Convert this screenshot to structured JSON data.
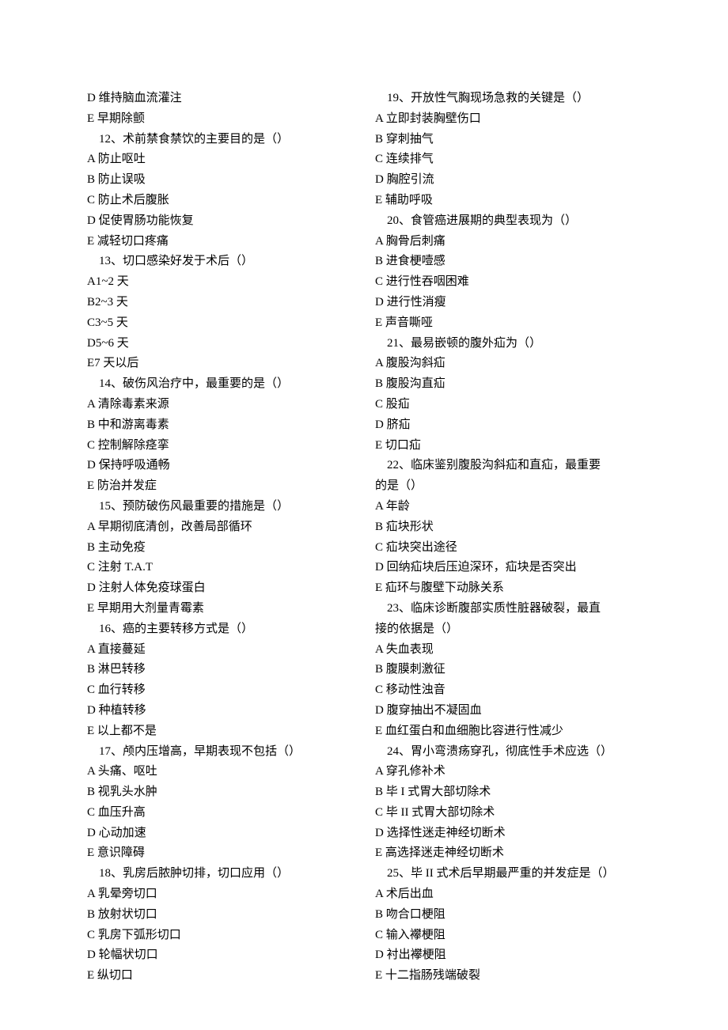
{
  "left": [
    {
      "t": "D 维持脑血流灌注"
    },
    {
      "t": "E 早期除颤"
    },
    {
      "t": "　12、术前禁食禁饮的主要目的是（）"
    },
    {
      "t": "A 防止呕吐"
    },
    {
      "t": "B 防止误吸"
    },
    {
      "t": "C 防止术后腹胀"
    },
    {
      "t": "D 促使胃肠功能恢复"
    },
    {
      "t": "E 减轻切口疼痛"
    },
    {
      "t": "　13、切口感染好发于术后（）"
    },
    {
      "t": "A1~2 天"
    },
    {
      "t": "B2~3 天"
    },
    {
      "t": "C3~5 天"
    },
    {
      "t": "D5~6 天"
    },
    {
      "t": "E7 天以后"
    },
    {
      "t": "　14、破伤风治疗中，最重要的是（）"
    },
    {
      "t": "A 清除毒素来源"
    },
    {
      "t": "B 中和游离毒素"
    },
    {
      "t": "C 控制解除痉挛"
    },
    {
      "t": "D 保持呼吸通畅"
    },
    {
      "t": "E 防治并发症"
    },
    {
      "t": "　15、预防破伤风最重要的措施是（）"
    },
    {
      "t": "A 早期彻底清创，改善局部循环"
    },
    {
      "t": "B 主动免疫"
    },
    {
      "t": "C 注射 T.A.T"
    },
    {
      "t": "D 注射人体免疫球蛋白"
    },
    {
      "t": "E 早期用大剂量青霉素"
    },
    {
      "t": "　16、癌的主要转移方式是（）"
    },
    {
      "t": "A  直接蔓延"
    },
    {
      "t": "B  淋巴转移"
    },
    {
      "t": "C 血行转移"
    },
    {
      "t": "D 种植转移"
    },
    {
      "t": "E 以上都不是"
    },
    {
      "t": "　17、颅内压增高，早期表现不包括（）"
    },
    {
      "t": "A 头痛、呕吐"
    },
    {
      "t": "B 视乳头水肿"
    },
    {
      "t": "C 血压升高"
    },
    {
      "t": "D 心动加速"
    },
    {
      "t": "E 意识障碍"
    },
    {
      "t": "　18、乳房后脓肿切排，切口应用（）"
    },
    {
      "t": "A 乳晕旁切口"
    },
    {
      "t": "B 放射状切口"
    },
    {
      "t": "C 乳房下弧形切口"
    },
    {
      "t": "D 轮幅状切口"
    },
    {
      "t": "E 纵切口"
    }
  ],
  "right": [
    {
      "t": "　19、开放性气胸现场急救的关键是（）"
    },
    {
      "t": "A 立即封装胸壁伤口"
    },
    {
      "t": "B 穿刺抽气"
    },
    {
      "t": "C 连续排气"
    },
    {
      "t": "D 胸腔引流"
    },
    {
      "t": "E 辅助呼吸"
    },
    {
      "t": "　20、食管癌进展期的典型表现为（）"
    },
    {
      "t": "A 胸骨后刺痛"
    },
    {
      "t": "B 进食梗噎感"
    },
    {
      "t": "C 进行性吞咽困难"
    },
    {
      "t": "D 进行性消瘦"
    },
    {
      "t": "E 声音嘶哑"
    },
    {
      "t": "　21、最易嵌顿的腹外疝为（）"
    },
    {
      "t": "A 腹股沟斜疝"
    },
    {
      "t": "B 腹股沟直疝"
    },
    {
      "t": "C 股疝"
    },
    {
      "t": "D 脐疝"
    },
    {
      "t": "E 切口疝"
    },
    {
      "t": "　22、临床鉴别腹股沟斜疝和直疝，最重要"
    },
    {
      "t": "的是（）"
    },
    {
      "t": "A 年龄"
    },
    {
      "t": "B 疝块形状"
    },
    {
      "t": "C 疝块突出途径"
    },
    {
      "t": "D 回纳疝块后压迫深环，疝块是否突出"
    },
    {
      "t": "E 疝环与腹壁下动脉关系"
    },
    {
      "t": "　23、临床诊断腹部实质性脏器破裂，最直"
    },
    {
      "t": "接的依据是（）"
    },
    {
      "t": "A 失血表现"
    },
    {
      "t": "B 腹膜刺激征"
    },
    {
      "t": "C 移动性浊音"
    },
    {
      "t": "D 腹穿抽出不凝固血"
    },
    {
      "t": "E 血红蛋白和血细胞比容进行性减少"
    },
    {
      "t": "　24、胃小弯溃疡穿孔，彻底性手术应选（）"
    },
    {
      "t": "A 穿孔修补术"
    },
    {
      "t": "B 毕 I 式胃大部切除术"
    },
    {
      "t": "C 毕 II 式胃大部切除术"
    },
    {
      "t": "D 选择性迷走神经切断术"
    },
    {
      "t": "E 高选择迷走神经切断术"
    },
    {
      "t": "　25、毕 II 式术后早期最严重的并发症是（）"
    },
    {
      "t": "A 术后出血"
    },
    {
      "t": "B 吻合口梗阻"
    },
    {
      "t": "C 输入襻梗阻"
    },
    {
      "t": "D 衬出襻梗阻"
    },
    {
      "t": "E 十二指肠残端破裂"
    }
  ]
}
